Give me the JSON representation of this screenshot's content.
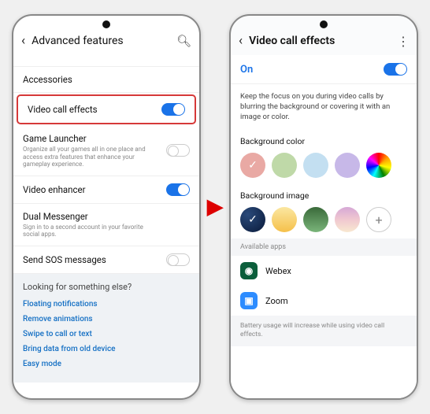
{
  "left": {
    "title": "Advanced features",
    "truncated_top": "______",
    "rows": [
      {
        "label": "Accessories",
        "sub": "",
        "toggle": null
      },
      {
        "label": "Video call effects",
        "sub": "",
        "toggle": "on",
        "highlight": true
      },
      {
        "label": "Game Launcher",
        "sub": "Organize all your games all in one place and access extra features that enhance your gameplay experience.",
        "toggle": "off-outline"
      },
      {
        "label": "Video enhancer",
        "sub": "",
        "toggle": "on"
      },
      {
        "label": "Dual Messenger",
        "sub": "Sign in to a second account in your favorite social apps.",
        "toggle": null
      },
      {
        "label": "Send SOS messages",
        "sub": "",
        "toggle": "off-outline"
      }
    ],
    "footer": {
      "heading": "Looking for something else?",
      "links": [
        "Floating notifications",
        "Remove animations",
        "Swipe to call or text",
        "Bring data from old device",
        "Easy mode"
      ]
    }
  },
  "right": {
    "title": "Video call effects",
    "on_label": "On",
    "description": "Keep the focus on you during video calls by blurring the background or covering it with an image or color.",
    "bg_color_label": "Background color",
    "bg_colors": [
      "#e9a9a4",
      "#bfd9a8",
      "#c3dff1",
      "#c7b8e8",
      "rainbow"
    ],
    "bg_color_selected": 0,
    "bg_image_label": "Background image",
    "bg_images": [
      "navy",
      "goldfish",
      "landscape",
      "sunset",
      "plus"
    ],
    "bg_image_selected": 0,
    "available_label": "Available apps",
    "apps": [
      {
        "name": "Webex",
        "icon_bg": "#0b5e3b",
        "icon_fg": "#fff",
        "icon_letter": "⬤"
      },
      {
        "name": "Zoom",
        "icon_bg": "#2d8cff",
        "icon_fg": "#fff",
        "icon_letter": "▣"
      }
    ],
    "bottom_note": "Battery usage will increase while using video call effects."
  }
}
